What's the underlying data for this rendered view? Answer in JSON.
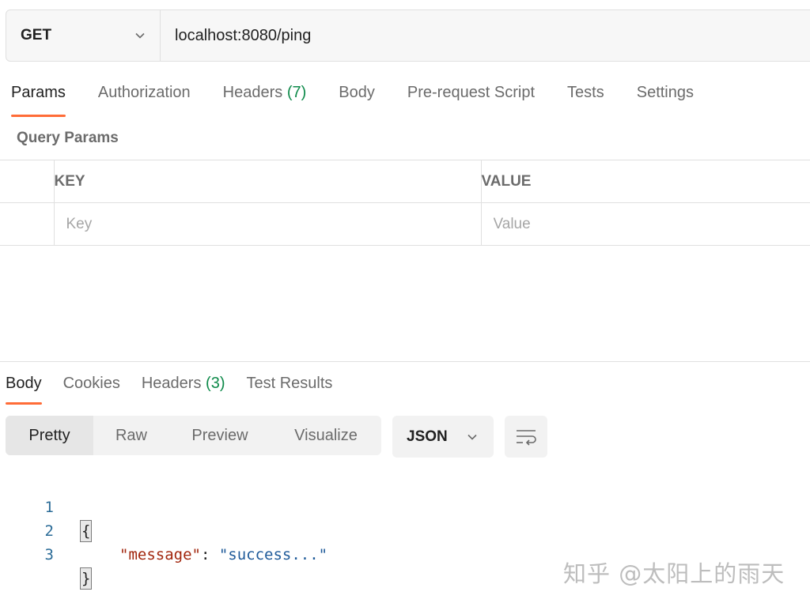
{
  "request": {
    "method": "GET",
    "url": "localhost:8080/ping"
  },
  "request_tabs": [
    {
      "label": "Params",
      "count": ""
    },
    {
      "label": "Authorization",
      "count": ""
    },
    {
      "label": "Headers",
      "count": "(7)"
    },
    {
      "label": "Body",
      "count": ""
    },
    {
      "label": "Pre-request Script",
      "count": ""
    },
    {
      "label": "Tests",
      "count": ""
    },
    {
      "label": "Settings",
      "count": ""
    }
  ],
  "query_params": {
    "title": "Query Params",
    "key_header": "KEY",
    "value_header": "VALUE",
    "key_placeholder": "Key",
    "value_placeholder": "Value"
  },
  "response_tabs": [
    {
      "label": "Body",
      "count": ""
    },
    {
      "label": "Cookies",
      "count": ""
    },
    {
      "label": "Headers",
      "count": "(3)"
    },
    {
      "label": "Test Results",
      "count": ""
    }
  ],
  "view_modes": [
    "Pretty",
    "Raw",
    "Preview",
    "Visualize"
  ],
  "format": "JSON",
  "code": {
    "line_numbers": [
      "1",
      "2",
      "3"
    ],
    "open_brace": "{",
    "key": "\"message\"",
    "colon": ": ",
    "value": "\"success...\"",
    "close_brace": "}"
  },
  "watermark": "知乎 @太阳上的雨天",
  "colors": {
    "accent": "#ff6c37",
    "count_green": "#0e8a4a",
    "json_key": "#a1260d",
    "json_string": "#1e5a99"
  }
}
